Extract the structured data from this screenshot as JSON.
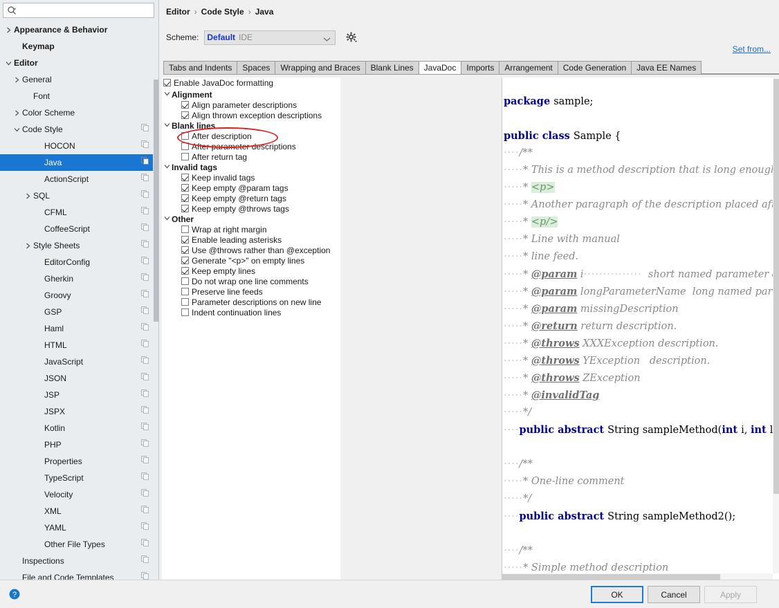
{
  "search": {
    "value": "",
    "placeholder": ""
  },
  "sidebar": {
    "items": [
      {
        "label": "Appearance & Behavior",
        "arrow": "right",
        "bold": true,
        "indent": 0,
        "copy": false,
        "selected": false
      },
      {
        "label": "Keymap",
        "arrow": "",
        "bold": true,
        "indent": 1,
        "copy": false,
        "selected": false
      },
      {
        "label": "Editor",
        "arrow": "down",
        "bold": true,
        "indent": 0,
        "copy": false,
        "selected": false
      },
      {
        "label": "General",
        "arrow": "right",
        "bold": false,
        "indent": 1,
        "copy": false,
        "selected": false
      },
      {
        "label": "Font",
        "arrow": "",
        "bold": false,
        "indent": 2,
        "copy": false,
        "selected": false
      },
      {
        "label": "Color Scheme",
        "arrow": "right",
        "bold": false,
        "indent": 1,
        "copy": false,
        "selected": false
      },
      {
        "label": "Code Style",
        "arrow": "down",
        "bold": false,
        "indent": 1,
        "copy": true,
        "selected": false
      },
      {
        "label": "HOCON",
        "arrow": "",
        "bold": false,
        "indent": 3,
        "copy": true,
        "selected": false
      },
      {
        "label": "Java",
        "arrow": "",
        "bold": false,
        "indent": 3,
        "copy": true,
        "selected": true
      },
      {
        "label": "ActionScript",
        "arrow": "",
        "bold": false,
        "indent": 3,
        "copy": true,
        "selected": false
      },
      {
        "label": "SQL",
        "arrow": "right",
        "bold": false,
        "indent": 2,
        "copy": true,
        "selected": false
      },
      {
        "label": "CFML",
        "arrow": "",
        "bold": false,
        "indent": 3,
        "copy": true,
        "selected": false
      },
      {
        "label": "CoffeeScript",
        "arrow": "",
        "bold": false,
        "indent": 3,
        "copy": true,
        "selected": false
      },
      {
        "label": "Style Sheets",
        "arrow": "right",
        "bold": false,
        "indent": 2,
        "copy": true,
        "selected": false
      },
      {
        "label": "EditorConfig",
        "arrow": "",
        "bold": false,
        "indent": 3,
        "copy": true,
        "selected": false
      },
      {
        "label": "Gherkin",
        "arrow": "",
        "bold": false,
        "indent": 3,
        "copy": true,
        "selected": false
      },
      {
        "label": "Groovy",
        "arrow": "",
        "bold": false,
        "indent": 3,
        "copy": true,
        "selected": false
      },
      {
        "label": "GSP",
        "arrow": "",
        "bold": false,
        "indent": 3,
        "copy": true,
        "selected": false
      },
      {
        "label": "Haml",
        "arrow": "",
        "bold": false,
        "indent": 3,
        "copy": true,
        "selected": false
      },
      {
        "label": "HTML",
        "arrow": "",
        "bold": false,
        "indent": 3,
        "copy": true,
        "selected": false
      },
      {
        "label": "JavaScript",
        "arrow": "",
        "bold": false,
        "indent": 3,
        "copy": true,
        "selected": false
      },
      {
        "label": "JSON",
        "arrow": "",
        "bold": false,
        "indent": 3,
        "copy": true,
        "selected": false
      },
      {
        "label": "JSP",
        "arrow": "",
        "bold": false,
        "indent": 3,
        "copy": true,
        "selected": false
      },
      {
        "label": "JSPX",
        "arrow": "",
        "bold": false,
        "indent": 3,
        "copy": true,
        "selected": false
      },
      {
        "label": "Kotlin",
        "arrow": "",
        "bold": false,
        "indent": 3,
        "copy": true,
        "selected": false
      },
      {
        "label": "PHP",
        "arrow": "",
        "bold": false,
        "indent": 3,
        "copy": true,
        "selected": false
      },
      {
        "label": "Properties",
        "arrow": "",
        "bold": false,
        "indent": 3,
        "copy": true,
        "selected": false
      },
      {
        "label": "TypeScript",
        "arrow": "",
        "bold": false,
        "indent": 3,
        "copy": true,
        "selected": false
      },
      {
        "label": "Velocity",
        "arrow": "",
        "bold": false,
        "indent": 3,
        "copy": true,
        "selected": false
      },
      {
        "label": "XML",
        "arrow": "",
        "bold": false,
        "indent": 3,
        "copy": true,
        "selected": false
      },
      {
        "label": "YAML",
        "arrow": "",
        "bold": false,
        "indent": 3,
        "copy": true,
        "selected": false
      },
      {
        "label": "Other File Types",
        "arrow": "",
        "bold": false,
        "indent": 3,
        "copy": true,
        "selected": false
      },
      {
        "label": "Inspections",
        "arrow": "",
        "bold": false,
        "indent": 1,
        "copy": true,
        "selected": false
      },
      {
        "label": "File and Code Templates",
        "arrow": "",
        "bold": false,
        "indent": 1,
        "copy": true,
        "selected": false
      }
    ]
  },
  "header": {
    "breadcrumb": [
      "Editor",
      "Code Style",
      "Java"
    ],
    "separator": "›",
    "scheme_label": "Scheme:",
    "scheme_name": "Default",
    "scheme_scope": "IDE",
    "set_from_label": "Set from..."
  },
  "tabs": [
    {
      "label": "Tabs and Indents",
      "active": false
    },
    {
      "label": "Spaces",
      "active": false
    },
    {
      "label": "Wrapping and Braces",
      "active": false
    },
    {
      "label": "Blank Lines",
      "active": false
    },
    {
      "label": "JavaDoc",
      "active": true
    },
    {
      "label": "Imports",
      "active": false
    },
    {
      "label": "Arrangement",
      "active": false
    },
    {
      "label": "Code Generation",
      "active": false
    },
    {
      "label": "Java EE Names",
      "active": false
    }
  ],
  "options": {
    "enable": {
      "label": "Enable JavaDoc formatting",
      "checked": true
    },
    "groups": [
      {
        "title": "Alignment",
        "expanded": true,
        "items": [
          {
            "label": "Align parameter descriptions",
            "checked": true
          },
          {
            "label": "Align thrown exception descriptions",
            "checked": true
          }
        ]
      },
      {
        "title": "Blank lines",
        "expanded": true,
        "items": [
          {
            "label": "After description",
            "checked": false,
            "highlighted": true
          },
          {
            "label": "After parameter descriptions",
            "checked": false
          },
          {
            "label": "After return tag",
            "checked": false
          }
        ]
      },
      {
        "title": "Invalid tags",
        "expanded": true,
        "items": [
          {
            "label": "Keep invalid tags",
            "checked": true
          },
          {
            "label": "Keep empty @param tags",
            "checked": true
          },
          {
            "label": "Keep empty @return tags",
            "checked": true
          },
          {
            "label": "Keep empty @throws tags",
            "checked": true
          }
        ]
      },
      {
        "title": "Other",
        "expanded": true,
        "items": [
          {
            "label": "Wrap at right margin",
            "checked": false
          },
          {
            "label": "Enable leading asterisks",
            "checked": true
          },
          {
            "label": "Use @throws rather than @exception",
            "checked": true
          },
          {
            "label": "Generate \"<p>\" on empty lines",
            "checked": true
          },
          {
            "label": "Keep empty lines",
            "checked": true
          },
          {
            "label": "Do not wrap one line comments",
            "checked": false
          },
          {
            "label": "Preserve line feeds",
            "checked": false
          },
          {
            "label": "Parameter descriptions on new line",
            "checked": false
          },
          {
            "label": "Indent continuation lines",
            "checked": false
          }
        ]
      }
    ]
  },
  "preview": {
    "lines": [
      [
        {
          "t": "package ",
          "c": "kw"
        },
        {
          "t": "sample;",
          "c": "pl"
        }
      ],
      [],
      [
        {
          "t": "public class ",
          "c": "kw"
        },
        {
          "t": "Sample {",
          "c": "pl"
        }
      ],
      [
        {
          "t": "    ",
          "c": "dots"
        },
        {
          "t": "/**",
          "c": "cm"
        }
      ],
      [
        {
          "t": "     ",
          "c": "dots"
        },
        {
          "t": "* This is a method description that is long enough to exceed righ",
          "c": "cm"
        }
      ],
      [
        {
          "t": "     ",
          "c": "dots"
        },
        {
          "t": "* ",
          "c": "cm"
        },
        {
          "t": "<p>",
          "c": "hl"
        }
      ],
      [
        {
          "t": "     ",
          "c": "dots"
        },
        {
          "t": "* Another paragraph of the description placed after blank line.",
          "c": "cm"
        }
      ],
      [
        {
          "t": "     ",
          "c": "dots"
        },
        {
          "t": "* ",
          "c": "cm"
        },
        {
          "t": "<p/>",
          "c": "hl"
        }
      ],
      [
        {
          "t": "     ",
          "c": "dots"
        },
        {
          "t": "* Line with manual",
          "c": "cm"
        }
      ],
      [
        {
          "t": "     ",
          "c": "dots"
        },
        {
          "t": "* line feed.",
          "c": "cm"
        }
      ],
      [
        {
          "t": "     ",
          "c": "dots"
        },
        {
          "t": "* ",
          "c": "cm"
        },
        {
          "t": "@param",
          "c": "tg"
        },
        {
          "t": " i",
          "c": "cm"
        },
        {
          "t": "               ",
          "c": "dots"
        },
        {
          "t": "  short named parameter description",
          "c": "cm"
        }
      ],
      [
        {
          "t": "     ",
          "c": "dots"
        },
        {
          "t": "* ",
          "c": "cm"
        },
        {
          "t": "@param",
          "c": "tg"
        },
        {
          "t": " longParameterName  long named parameter description",
          "c": "cm"
        }
      ],
      [
        {
          "t": "     ",
          "c": "dots"
        },
        {
          "t": "* ",
          "c": "cm"
        },
        {
          "t": "@param",
          "c": "tg"
        },
        {
          "t": " missingDescription",
          "c": "cm"
        }
      ],
      [
        {
          "t": "     ",
          "c": "dots"
        },
        {
          "t": "* ",
          "c": "cm"
        },
        {
          "t": "@return",
          "c": "tg"
        },
        {
          "t": " return description.",
          "c": "cm"
        }
      ],
      [
        {
          "t": "     ",
          "c": "dots"
        },
        {
          "t": "* ",
          "c": "cm"
        },
        {
          "t": "@throws",
          "c": "tg"
        },
        {
          "t": " XXXException description.",
          "c": "cm"
        }
      ],
      [
        {
          "t": "     ",
          "c": "dots"
        },
        {
          "t": "* ",
          "c": "cm"
        },
        {
          "t": "@throws",
          "c": "tg"
        },
        {
          "t": " YException   description.",
          "c": "cm"
        }
      ],
      [
        {
          "t": "     ",
          "c": "dots"
        },
        {
          "t": "* ",
          "c": "cm"
        },
        {
          "t": "@throws",
          "c": "tg"
        },
        {
          "t": " ZException",
          "c": "cm"
        }
      ],
      [
        {
          "t": "     ",
          "c": "dots"
        },
        {
          "t": "* ",
          "c": "cm"
        },
        {
          "t": "@invalidTag",
          "c": "tg"
        }
      ],
      [
        {
          "t": "     ",
          "c": "dots"
        },
        {
          "t": "*/",
          "c": "cm"
        }
      ],
      [
        {
          "t": "    ",
          "c": "dots"
        },
        {
          "t": "public abstract ",
          "c": "kw"
        },
        {
          "t": "String sampleMethod(",
          "c": "pl"
        },
        {
          "t": "int ",
          "c": "kw"
        },
        {
          "t": "i, ",
          "c": "pl"
        },
        {
          "t": "int ",
          "c": "kw"
        },
        {
          "t": "longParameterName,",
          "c": "pl"
        }
      ],
      [],
      [
        {
          "t": "    ",
          "c": "dots"
        },
        {
          "t": "/**",
          "c": "cm"
        }
      ],
      [
        {
          "t": "     ",
          "c": "dots"
        },
        {
          "t": "* One-line comment",
          "c": "cm"
        }
      ],
      [
        {
          "t": "     ",
          "c": "dots"
        },
        {
          "t": "*/",
          "c": "cm"
        }
      ],
      [
        {
          "t": "    ",
          "c": "dots"
        },
        {
          "t": "public abstract ",
          "c": "kw"
        },
        {
          "t": "String sampleMethod2();",
          "c": "pl"
        }
      ],
      [],
      [
        {
          "t": "    ",
          "c": "dots"
        },
        {
          "t": "/**",
          "c": "cm"
        }
      ],
      [
        {
          "t": "     ",
          "c": "dots"
        },
        {
          "t": "* Simple method description",
          "c": "cm"
        }
      ]
    ]
  },
  "footer": {
    "ok_label": "OK",
    "cancel_label": "Cancel",
    "apply_label": "Apply"
  }
}
